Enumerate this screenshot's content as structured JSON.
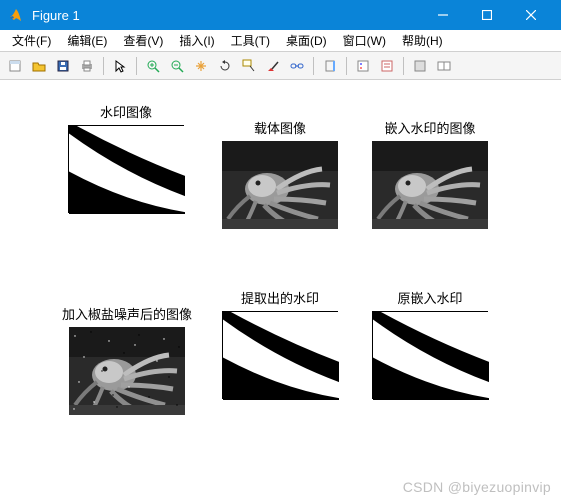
{
  "window": {
    "title": "Figure 1"
  },
  "menu": {
    "file": "文件(F)",
    "edit": "编辑(E)",
    "view": "查看(V)",
    "insert": "插入(I)",
    "tools": "工具(T)",
    "desktop": "桌面(D)",
    "window": "窗口(W)",
    "help": "帮助(H)"
  },
  "subplots": {
    "t1": "水印图像",
    "t2": "载体图像",
    "t3": "嵌入水印的图像",
    "t4": "加入椒盐噪声后的图像",
    "t5": "提取出的水印",
    "t6": "原嵌入水印"
  },
  "watermark": "CSDN @biyezuopinvip"
}
